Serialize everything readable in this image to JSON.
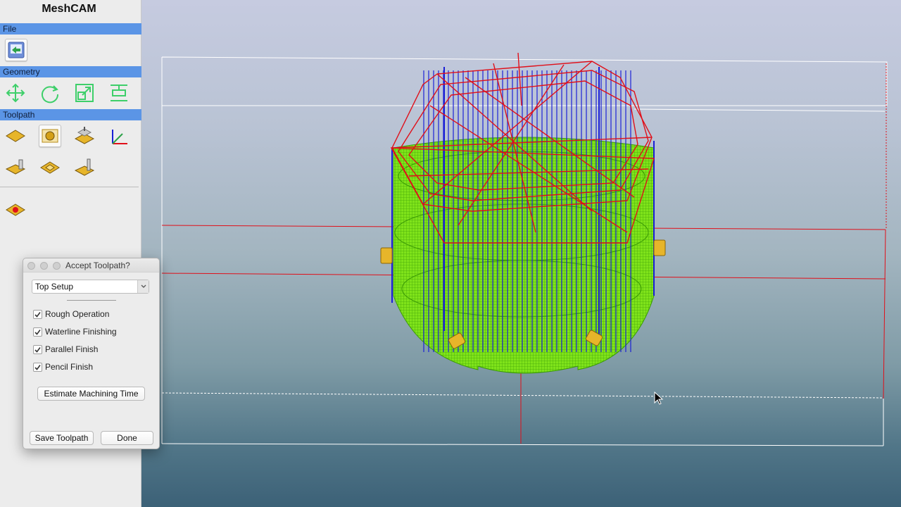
{
  "app": {
    "title": "MeshCAM"
  },
  "panel": {
    "sections": {
      "file": "File",
      "geometry": "Geometry",
      "toolpath": "Toolpath"
    },
    "file_tools": [
      "open-file-icon"
    ],
    "geometry_tools": [
      "move-icon",
      "rotate-icon",
      "scale-icon",
      "align-icon"
    ],
    "toolpath_tools": [
      "stock-icon",
      "sphere-tool-icon",
      "machining-region-icon",
      "origin-axes-icon",
      "depth-setup-icon",
      "plate-icon",
      "tool-height-icon"
    ],
    "extra_tools": [
      "generate-toolpath-icon"
    ]
  },
  "dialog": {
    "title": "Accept Toolpath?",
    "setup_selected": "Top Setup",
    "operations": [
      {
        "label": "Rough Operation",
        "checked": true
      },
      {
        "label": "Waterline Finishing",
        "checked": true
      },
      {
        "label": "Parallel Finish",
        "checked": true
      },
      {
        "label": "Pencil Finish",
        "checked": true
      }
    ],
    "estimate_label": "Estimate Machining Time",
    "save_label": "Save Toolpath",
    "done_label": "Done"
  },
  "colors": {
    "panel_bg": "#ececec",
    "section_bar": "#5b95e6",
    "toolpath_red": "#e0101a",
    "toolpath_blue": "#1a1fd6",
    "toolpath_green": "#6fe00a",
    "part_gold": "#e7b52a"
  }
}
